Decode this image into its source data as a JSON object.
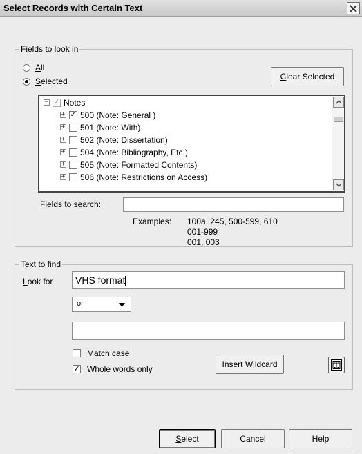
{
  "window": {
    "title": "Select Records with Certain Text"
  },
  "fields_group": {
    "legend": "Fields to look in",
    "radio_all": "All",
    "radio_selected": "Selected",
    "clear_selected_button": "Clear Selected",
    "tree": {
      "root": {
        "label": "Notes",
        "expander": "−",
        "checked": true
      },
      "items": [
        {
          "expander": "+",
          "checked": true,
          "label": "500 (Note: General )"
        },
        {
          "expander": "+",
          "checked": false,
          "label": "501 (Note: With)"
        },
        {
          "expander": "+",
          "checked": false,
          "label": "502 (Note: Dissertation)"
        },
        {
          "expander": "+",
          "checked": false,
          "label": "504 (Note: Bibliography, Etc.)"
        },
        {
          "expander": "+",
          "checked": false,
          "label": "505 (Note: Formatted Contents)"
        },
        {
          "expander": "+",
          "checked": false,
          "label": "506 (Note: Restrictions on Access)"
        }
      ]
    },
    "fields_to_search_label": "Fields to search:",
    "fields_to_search_value": "",
    "examples_label": "Examples:",
    "examples": [
      "100a, 245, 500-599, 610",
      "001-999",
      "001, 003"
    ]
  },
  "text_group": {
    "legend": "Text to find",
    "look_for_label": "Look for",
    "look_for_value": "VHS format",
    "operator_value": "or",
    "second_value": "",
    "match_case_label": "Match case",
    "match_case_checked": false,
    "whole_words_label": "Whole words only",
    "whole_words_checked": true,
    "insert_wildcard_button": "Insert Wildcard"
  },
  "footer": {
    "select_button": "Select",
    "cancel_button": "Cancel",
    "help_button": "Help"
  }
}
